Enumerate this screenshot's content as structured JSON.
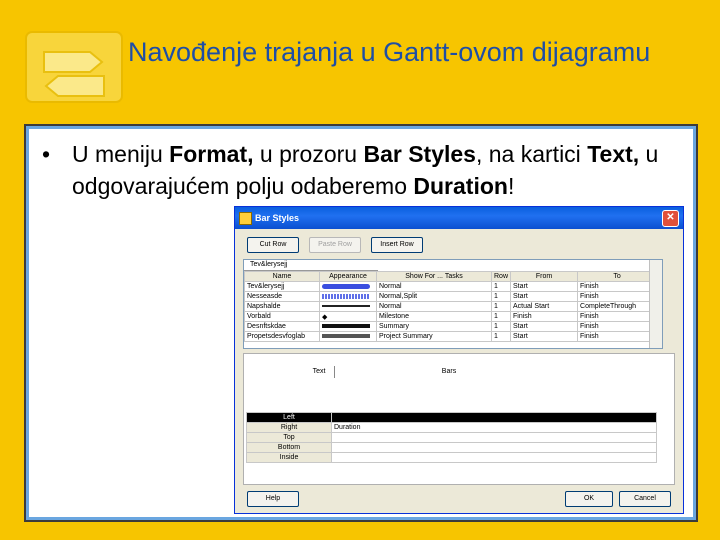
{
  "slide": {
    "title": "Navođenje trajanja u Gantt-ovom dijagramu",
    "bullet": {
      "t1": "U meniju ",
      "b1": "Format,",
      "t2": " u prozoru ",
      "b2": "Bar Styles",
      "t3": ", na kartici ",
      "b3": "Text,",
      "t4": " u odgovarajućem polju odaberemo ",
      "b4": "Duration",
      "t5": "!"
    }
  },
  "dialog": {
    "title": "Bar Styles",
    "close": "✕",
    "buttons": {
      "cut": "Cut Row",
      "paste": "Paste Row",
      "insert": "Insert Row",
      "help": "Help",
      "ok": "OK",
      "cancel": "Cancel"
    },
    "grid": {
      "current": "Tev&lerysejj",
      "headers": [
        "Name",
        "Appearance",
        "Show For ... Tasks",
        "Row",
        "From",
        "To"
      ],
      "rows": [
        {
          "name": "Tev&lerysejj",
          "show": "Normal",
          "row": "1",
          "from": "Start",
          "to": "Finish",
          "bar_color": "#3a4ee0"
        },
        {
          "name": "Nesseasde",
          "show": "Normal,Split",
          "row": "1",
          "from": "Start",
          "to": "Finish",
          "bar_color": "#6070e8"
        },
        {
          "name": "Napshalde",
          "show": "Normal",
          "row": "1",
          "from": "Actual Start",
          "to": "CompleteThrough",
          "bar_color": "#222222"
        },
        {
          "name": "Vorbald",
          "show": "Milestone",
          "row": "1",
          "from": "Finish",
          "to": "Finish",
          "bar_color": "#000000"
        },
        {
          "name": "Desnftskdae",
          "show": "Summary",
          "row": "1",
          "from": "Start",
          "to": "Finish",
          "bar_color": "#111111"
        },
        {
          "name": "Propetsdesvfoglab",
          "show": "Project Summary",
          "row": "1",
          "from": "Start",
          "to": "Finish",
          "bar_color": "#555555"
        }
      ]
    },
    "tabs": {
      "text": "Text",
      "bars": "Bars"
    },
    "text_table": [
      {
        "label": "Left",
        "value": ""
      },
      {
        "label": "Right",
        "value": "Duration"
      },
      {
        "label": "Top",
        "value": ""
      },
      {
        "label": "Bottom",
        "value": ""
      },
      {
        "label": "Inside",
        "value": ""
      }
    ]
  }
}
